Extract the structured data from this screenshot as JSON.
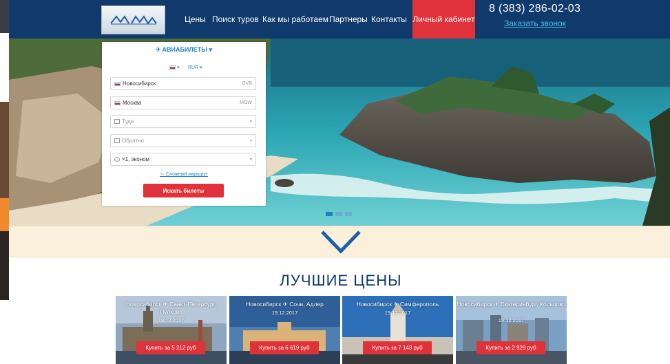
{
  "header": {
    "nav": [
      "Цены",
      "Поиск туров",
      "Как мы работаем",
      "Партнеры",
      "Контакты"
    ],
    "cabinet": "Личный кабинет",
    "phone": "8 (383) 286-02-03",
    "callback": "Заказать звонок"
  },
  "widget": {
    "title": "АВИАБИЛЕТЫ",
    "currency": "RUR",
    "from_city": "Новосибирск",
    "from_code": "OVB",
    "to_city": "Москва",
    "to_code": "MOW",
    "depart_placeholder": "Туда",
    "return_placeholder": "Обратно",
    "passengers": "×1, эконом",
    "complex_route": "Сложный маршрут",
    "search_button": "Искать билеты"
  },
  "section": {
    "title": "ЛУЧШИЕ ЦЕНЫ"
  },
  "deals": [
    {
      "route": "Новосибирск ✈ Санкт-Петербург, Пулково",
      "date": "19.12.2017",
      "button": "Купить за 5 212 руб"
    },
    {
      "route": "Новосибирск ✈ Сочи, Адлер",
      "date": "19.12.2017",
      "button": "Купить за 6 619 руб"
    },
    {
      "route": "Новосибирск ✈ Симферополь",
      "date": "19.12.2017",
      "button": "Купить за 7 143 руб"
    },
    {
      "route": "Новосибирск ✈ Екатеринбург, Кольцово",
      "date": "19.12.2017",
      "button": "Купить за 2 929 руб"
    }
  ],
  "colors": {
    "header": "#0f3a6b",
    "accent_red": "#e0323a",
    "link_blue": "#1e88c9",
    "band": "#fbf0dc"
  }
}
